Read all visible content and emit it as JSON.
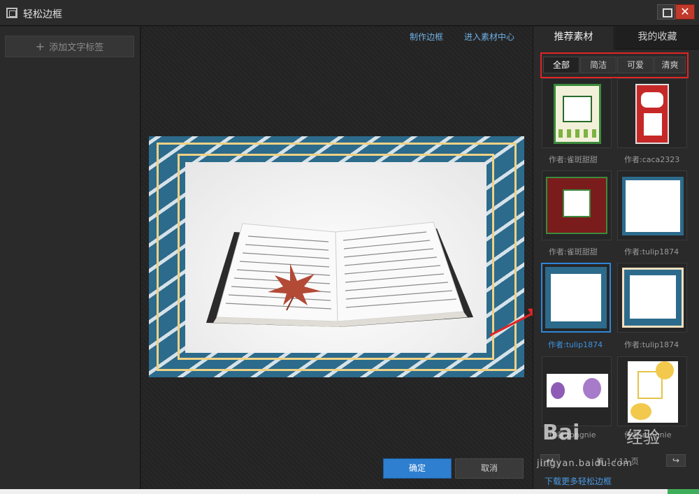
{
  "window": {
    "title": "轻松边框",
    "maximize_icon": "maximize-icon",
    "close_icon": "close-icon",
    "close_glyph": "✕"
  },
  "left_panel": {
    "add_text_label_button": "添加文字标签",
    "plus_glyph": "+"
  },
  "center": {
    "links": {
      "make_frame": "制作边框",
      "material_center": "进入素材中心"
    },
    "ok_button": "确定",
    "cancel_button": "取消"
  },
  "right_panel": {
    "tabs": [
      {
        "label": "推荐素材",
        "active": true
      },
      {
        "label": "我的收藏",
        "active": false
      }
    ],
    "filters": [
      {
        "label": "全部",
        "active": true
      },
      {
        "label": "简洁",
        "active": false
      },
      {
        "label": "可爱",
        "active": false
      },
      {
        "label": "清爽",
        "active": false
      }
    ],
    "frames": [
      {
        "author": "作者:雀斑甜甜",
        "style": "green-leaf",
        "selected": false
      },
      {
        "author": "作者:caca2323",
        "style": "red-happy",
        "selected": false
      },
      {
        "author": "作者:雀斑甜甜",
        "style": "red-green",
        "selected": false
      },
      {
        "author": "作者:tulip1874",
        "style": "blue-simple",
        "selected": false
      },
      {
        "author": "作者:tulip1874",
        "style": "blue-white",
        "selected": true
      },
      {
        "author": "作者:tulip1874",
        "style": "blue-cream",
        "selected": false
      },
      {
        "author": "作者:rongnie",
        "style": "purple-flower",
        "selected": false
      },
      {
        "author": "作者:rongnie",
        "style": "yellow-flower",
        "selected": false
      }
    ],
    "pager": {
      "prev_glyph": "↩",
      "next_glyph": "↪",
      "text": "第 1 / 11 页"
    },
    "download_more_link": "下载更多轻松边框"
  },
  "watermark": {
    "logo": "Bai",
    "logo_suffix": "经验",
    "url": "jingyan.baidu.com"
  },
  "colors": {
    "accent_blue": "#2f7fd0",
    "highlight_red": "#e02424",
    "frame_blue": "#2c6b8c",
    "frame_gold": "#f0d285"
  }
}
